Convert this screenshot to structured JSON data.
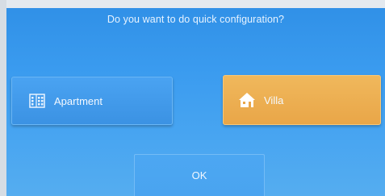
{
  "dialog": {
    "title": "Do you want to do quick configuration?"
  },
  "options": [
    {
      "label": "Apartment",
      "icon": "apartment-building-icon",
      "selected": false
    },
    {
      "label": "Villa",
      "icon": "villa-house-icon",
      "selected": true
    }
  ],
  "actions": {
    "ok_label": "OK"
  },
  "colors": {
    "background": "#3a9bef",
    "selected_option": "#eca94b",
    "text": "#f4f9ff"
  }
}
